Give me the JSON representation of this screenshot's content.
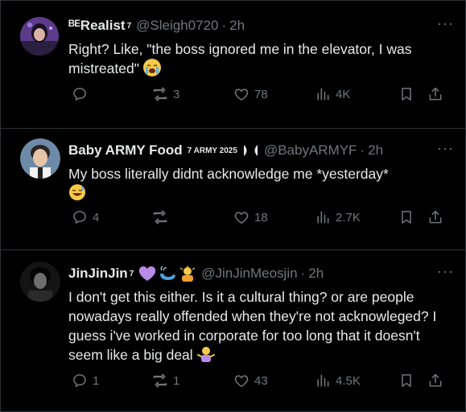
{
  "colors": {
    "bg": "#000000",
    "text": "#e7e9ea",
    "muted": "#71767b",
    "divider": "#2f3336",
    "emoji_yellow": "#f7c948",
    "heart_purple": "#b78be6"
  },
  "posts": [
    {
      "name": "ᴮᴱRealist",
      "name_sup": "7",
      "handle": "@Sleigh0720",
      "time": "2h",
      "text": "Right? Like, \"the boss ignored me in the elevator, I was mistreated\"",
      "emoji": "loudly-crying-face-emoji",
      "reply_count": "",
      "repost_count": "3",
      "like_count": "78",
      "views_count": "4K"
    },
    {
      "name": "Baby ARMY Food",
      "name_sup": "7 ARMY 2025",
      "handle": "@BabyARMYF",
      "time": "2h",
      "text": "My boss literally didnt acknowledge me *yesterday*",
      "emoji": "grinning-sweat-emoji",
      "reply_count": "4",
      "repost_count": "",
      "like_count": "18",
      "views_count": "2.7K"
    },
    {
      "name": "JinJinJin",
      "name_sup": "7",
      "handle": "@JinJinMeosjin",
      "time": "2h",
      "text": "I don't get this either. Is it a cultural thing? or are people nowadays really offended when they're not acknowleged? I guess i've worked in corporate for too long that it doesn't seem like a big deal",
      "emoji": "person-shrugging-emoji",
      "reply_count": "1",
      "repost_count": "1",
      "like_count": "43",
      "views_count": "4.5K"
    }
  ],
  "dot": "·",
  "more": "···"
}
